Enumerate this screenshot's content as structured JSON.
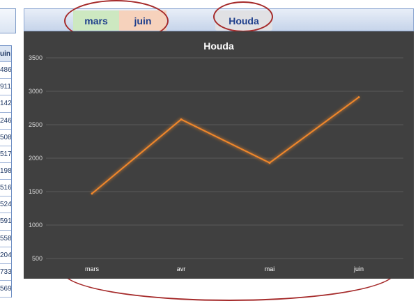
{
  "left_table": {
    "header": "uin",
    "cells": [
      "486",
      "911",
      "142",
      "246",
      "508",
      "517",
      "198",
      "516",
      "524",
      "591",
      "558",
      "204",
      "733",
      "569"
    ]
  },
  "toolbar": {
    "buttons": [
      {
        "label": "mars",
        "color": "#cde8c1"
      },
      {
        "label": "juin",
        "color": "#f6d2bc"
      },
      {
        "label": "Houda",
        "color": "#e1e1e4"
      }
    ]
  },
  "chart_data": {
    "type": "line",
    "title": "Houda",
    "categories": [
      "mars",
      "avr",
      "mai",
      "juin"
    ],
    "series": [
      {
        "values": [
          1470,
          2580,
          1930,
          2910
        ],
        "color": "#f0872c"
      }
    ],
    "yticks": [
      500,
      1000,
      1500,
      2000,
      2500,
      3000,
      3500
    ],
    "ylim": [
      0,
      3500
    ],
    "grid": true,
    "background": "#404040"
  },
  "colors": {
    "annotation": "#a52a2a",
    "button_text": "#1f3f8c"
  }
}
